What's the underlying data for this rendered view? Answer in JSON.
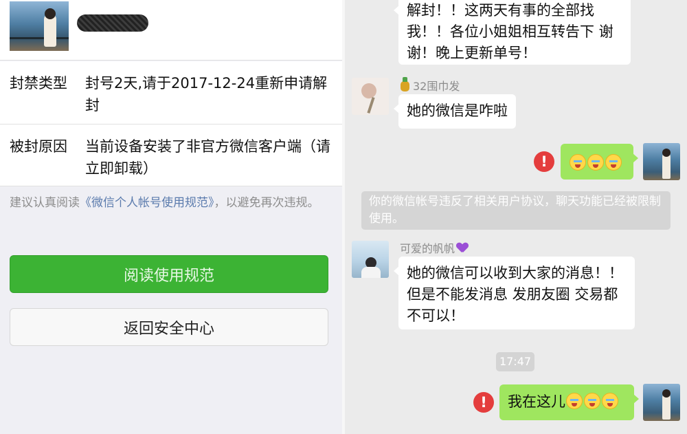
{
  "left_panel": {
    "ban_type": {
      "label": "封禁类型",
      "value": "封号2天,请于2017-12-24重新申请解封"
    },
    "ban_reason": {
      "label": "被封原因",
      "value": "当前设备安装了非官方微信客户端（请立即卸载）"
    },
    "advice": {
      "prefix": "建议认真阅读",
      "link": "《微信个人帐号使用规范》",
      "suffix": "，以避免再次违规。"
    },
    "read_button": "阅读使用规范",
    "back_button": "返回安全中心"
  },
  "chat": {
    "messages": [
      {
        "text": "解封！！这两天有事的全部找我！！各位小姐姐相互转告下 谢谢！晚上更新单号！"
      },
      {
        "sender": "32围巾发",
        "text": "她的微信是咋啦"
      },
      {
        "sender": "可爱的帆帆",
        "text": "她的微信可以收到大家的消息！！但是不能发消息 发朋友圈 交易都不可以！"
      },
      {
        "text": "我在这儿"
      }
    ],
    "system_notice": "你的微信帐号违反了相关用户协议，聊天功能已经被限制使用。",
    "timestamp": "17:47",
    "error_mark": "!",
    "colors": {
      "outgoing_bubble": "#9fe65f",
      "primary_button": "#3cb334",
      "error": "#e43d3d",
      "link": "#5b7bad"
    }
  }
}
